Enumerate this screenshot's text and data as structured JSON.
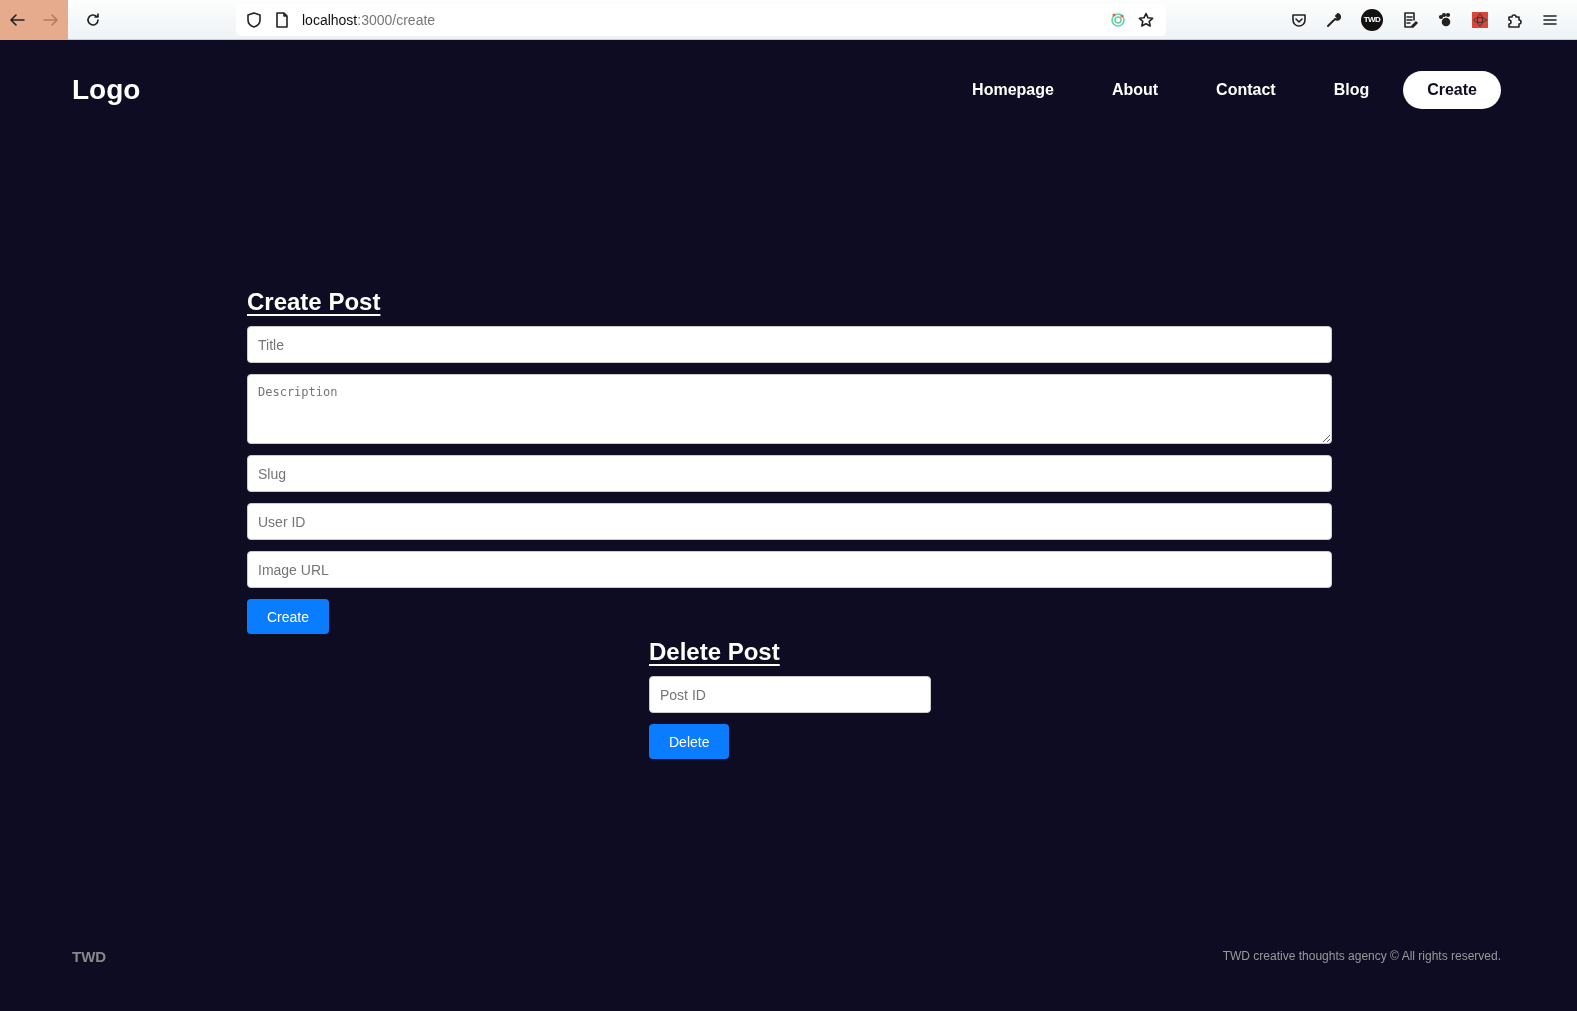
{
  "browser": {
    "nav_buttons": [
      {
        "kind": "back",
        "disabled": false
      },
      {
        "kind": "forward",
        "disabled": true
      },
      {
        "kind": "reload",
        "disabled": false
      }
    ],
    "url_host": "localhost",
    "url_path": ":3000/create",
    "extension_badge": "TWD"
  },
  "header": {
    "logo": "Logo",
    "nav": [
      {
        "label": "Homepage",
        "selected": false
      },
      {
        "label": "About",
        "selected": false
      },
      {
        "label": "Contact",
        "selected": false
      },
      {
        "label": "Blog",
        "selected": false
      },
      {
        "label": "Create",
        "selected": true
      }
    ]
  },
  "create_form": {
    "heading": "Create Post",
    "fields": [
      {
        "kind": "input",
        "placeholder": "Title"
      },
      {
        "kind": "textarea",
        "placeholder": "Description"
      },
      {
        "kind": "input",
        "placeholder": "Slug"
      },
      {
        "kind": "input",
        "placeholder": "User ID"
      },
      {
        "kind": "input",
        "placeholder": "Image URL"
      }
    ],
    "button": "Create"
  },
  "delete_form": {
    "heading": "Delete Post",
    "fields": [
      {
        "kind": "input",
        "placeholder": "Post ID"
      }
    ],
    "button": "Delete"
  },
  "footer": {
    "brand": "TWD",
    "copyright": "TWD creative thoughts agency © All rights reserved."
  }
}
